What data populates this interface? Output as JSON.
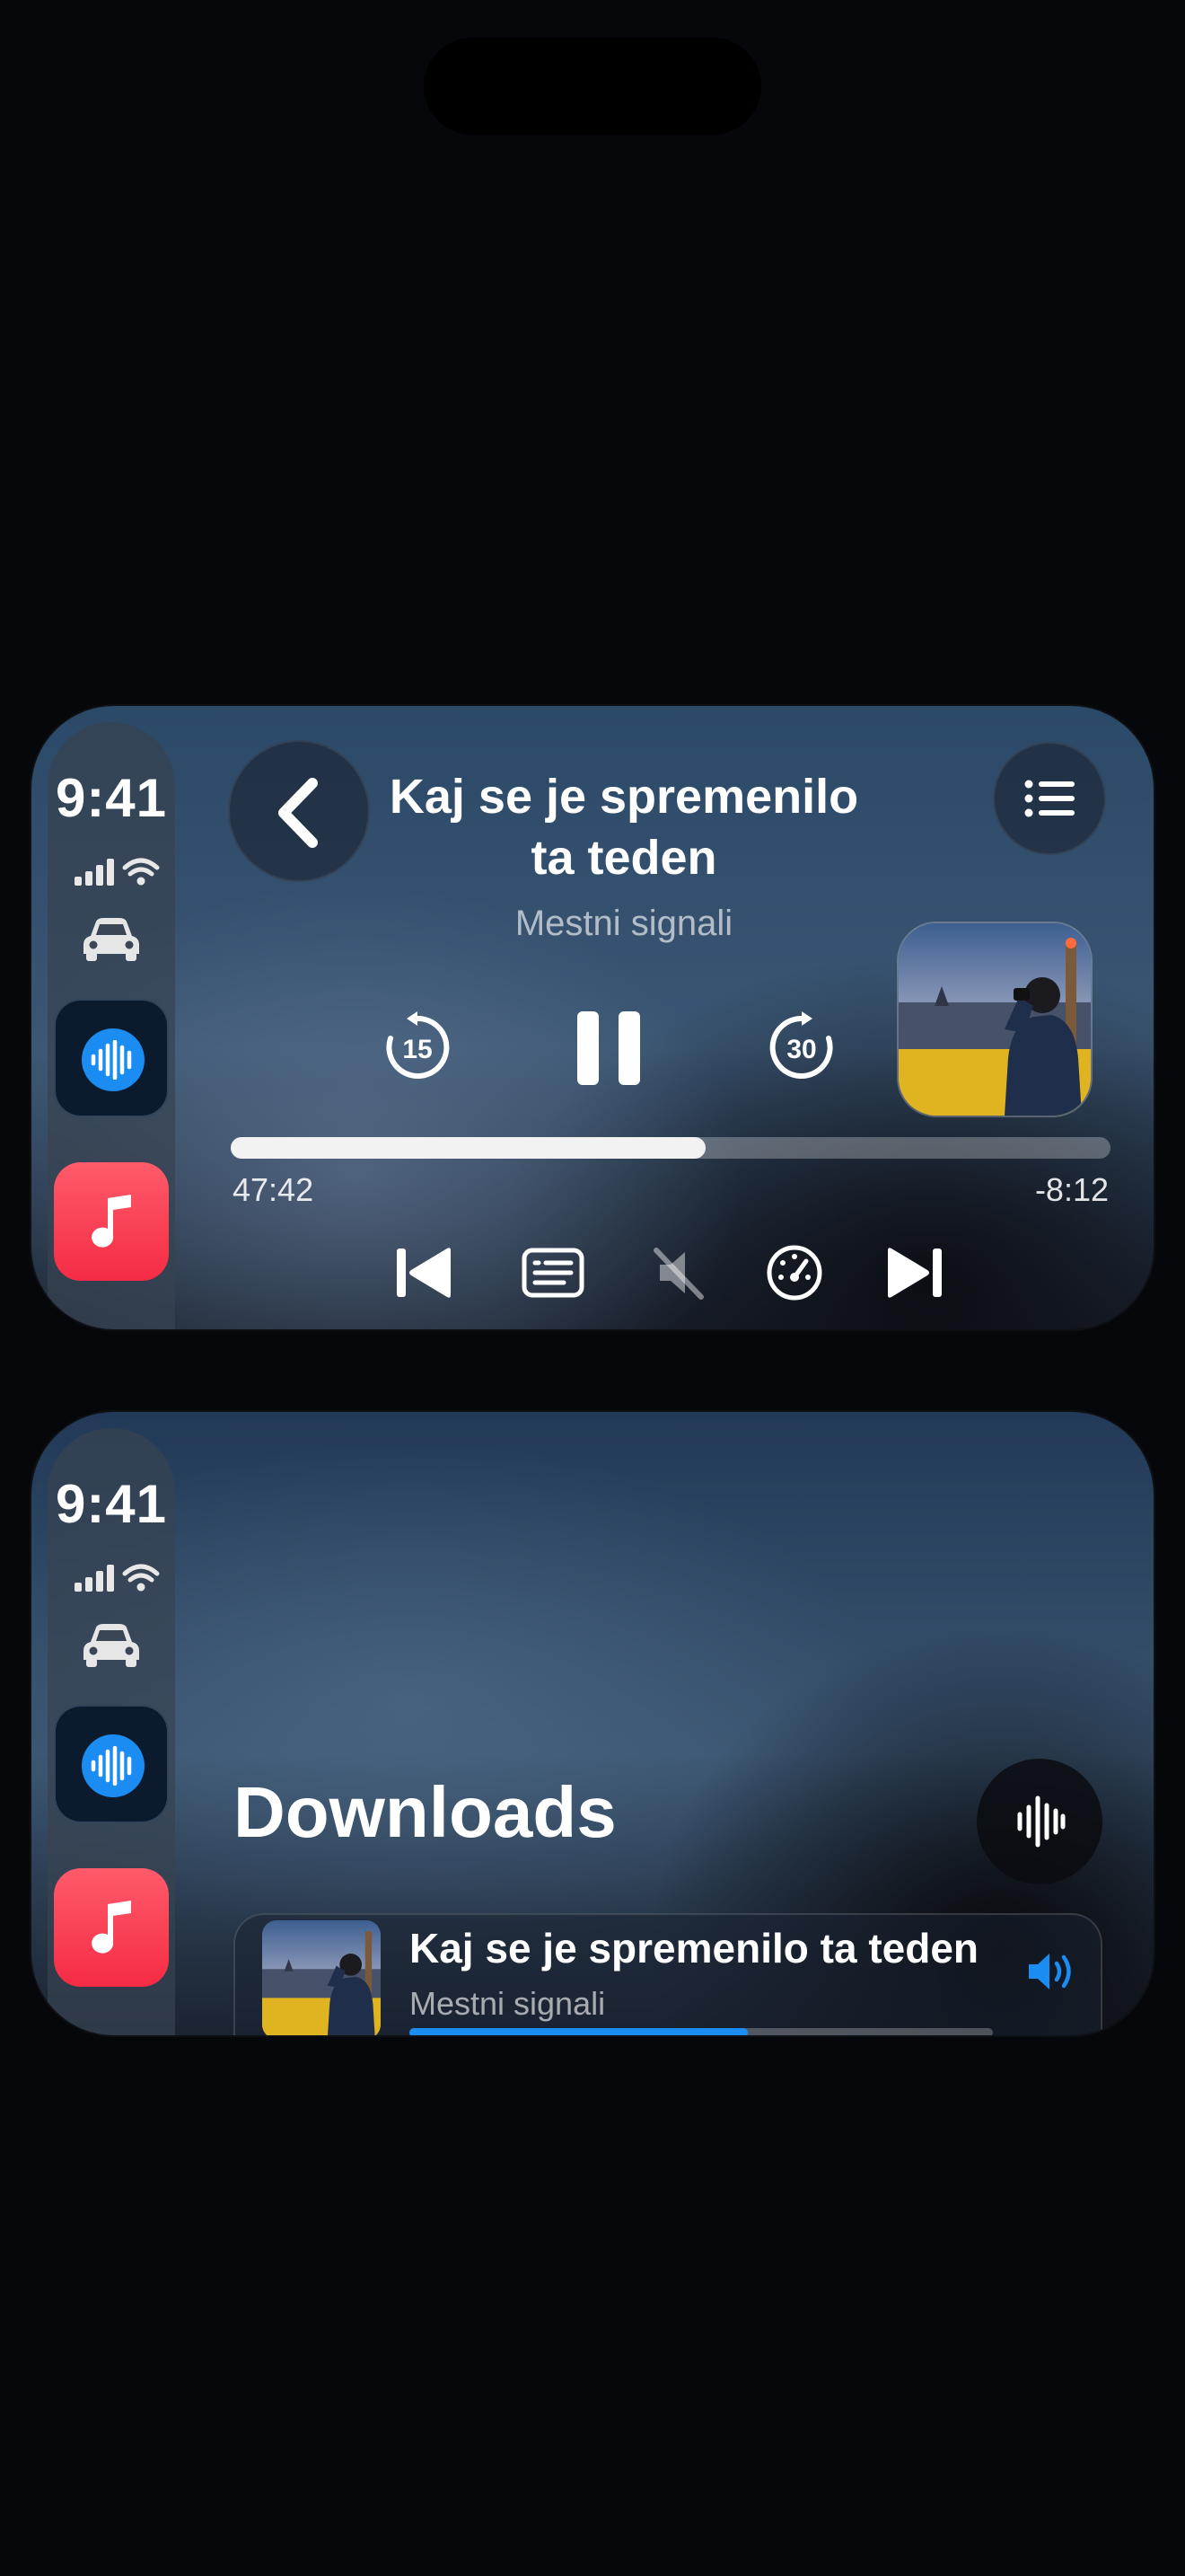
{
  "status_bar": {
    "time": "9:41",
    "signal_bars": 4,
    "wifi": true
  },
  "sidebar": {
    "apps": [
      {
        "name": "car-icon"
      },
      {
        "name": "podcasts-app-icon",
        "active": true
      },
      {
        "name": "music-app-icon"
      }
    ]
  },
  "now_playing": {
    "title_line1": "Kaj se je spremenilo",
    "title_line2": "ta teden",
    "show": "Mestni signali",
    "skip_back_seconds": "15",
    "skip_forward_seconds": "30",
    "elapsed": "47:42",
    "remaining": "-8:12",
    "progress": 0.54,
    "state": "playing"
  },
  "downloads": {
    "heading": "Downloads",
    "items": [
      {
        "title": "Kaj se je spremenilo ta teden",
        "show": "Mestni signali",
        "progress": 0.58,
        "playing": true
      }
    ]
  },
  "colors": {
    "accent": "#1a8cf2",
    "music_red": "#f52b45",
    "background": "#05070b"
  }
}
